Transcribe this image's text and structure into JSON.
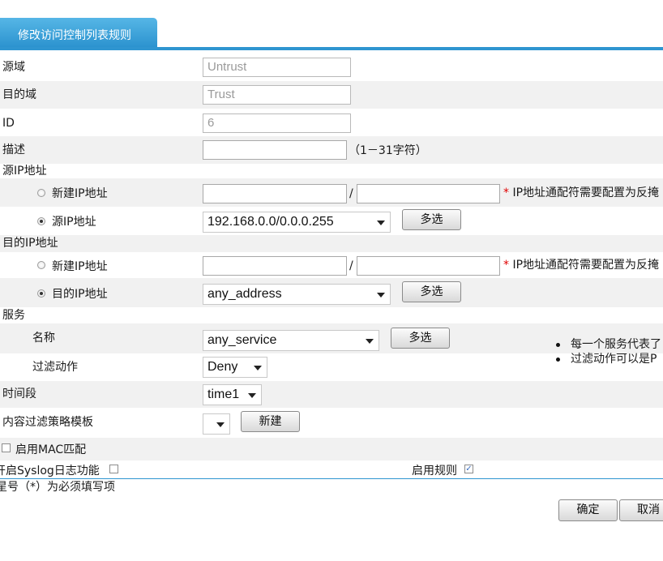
{
  "tab": {
    "title": "修改访问控制列表规则"
  },
  "src_zone": {
    "label": "源域",
    "value": "Untrust"
  },
  "dst_zone": {
    "label": "目的域",
    "value": "Trust"
  },
  "id": {
    "label": "ID",
    "value": "6"
  },
  "desc": {
    "label": "描述",
    "value": "",
    "hint": "（1－31字符）"
  },
  "src_ip": {
    "section": "源IP地址",
    "new_label": "新建IP地址",
    "sep": "/",
    "note": "IP地址通配符需要配置为反掩",
    "sel_label": "源IP地址",
    "sel_value": "192.168.0.0/0.0.0.255",
    "multi": "多选"
  },
  "dst_ip": {
    "section": "目的IP地址",
    "new_label": "新建IP地址",
    "sep": "/",
    "note": "IP地址通配符需要配置为反掩",
    "sel_label": "目的IP地址",
    "sel_value": "any_address",
    "multi": "多选"
  },
  "service": {
    "section": "服务",
    "name_label": "名称",
    "name_value": "any_service",
    "multi": "多选",
    "action_label": "过滤动作",
    "action_value": "Deny",
    "tips": [
      "每一个服务代表了",
      "过滤动作可以是P"
    ]
  },
  "time": {
    "label": "时间段",
    "value": "time1"
  },
  "content": {
    "label": "内容过滤策略模板",
    "value": "",
    "new_button": "新建"
  },
  "mac": {
    "label": "启用MAC匹配",
    "checked": false
  },
  "syslog": {
    "label": "开启Syslog日志功能",
    "checked": false
  },
  "enable": {
    "label": "启用规则",
    "checked": true
  },
  "footnote": "星号（*）为必须填写项",
  "footer": {
    "ok": "确定",
    "cancel": "取消"
  },
  "colors": {
    "accent": "#2f95d0",
    "required": "#e00000",
    "row_shade": "#f1f1f1"
  }
}
